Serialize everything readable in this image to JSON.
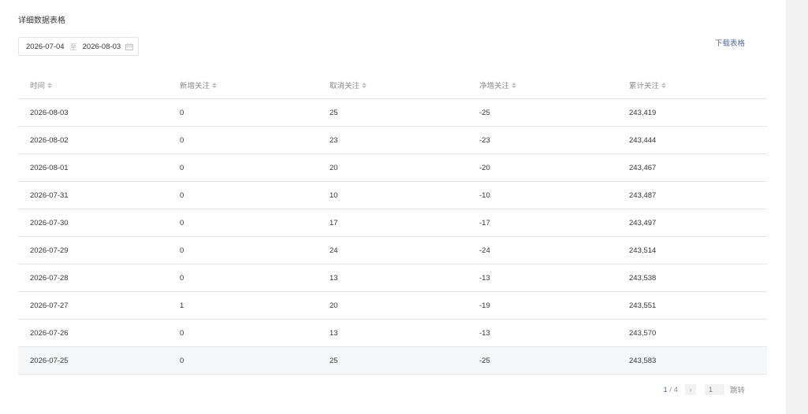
{
  "section_title": "详细数据表格",
  "date_range": {
    "start": "2026-07-04",
    "separator": "至",
    "end": "2026-08-03",
    "icon": "calendar-icon"
  },
  "download_label": "下载表格",
  "table": {
    "columns": [
      "时间",
      "新增关注",
      "取消关注",
      "净增关注",
      "累计关注"
    ],
    "rows": [
      [
        "2026-08-03",
        "0",
        "25",
        "-25",
        "243,419"
      ],
      [
        "2026-08-02",
        "0",
        "23",
        "-23",
        "243,444"
      ],
      [
        "2026-08-01",
        "0",
        "20",
        "-20",
        "243,467"
      ],
      [
        "2026-07-31",
        "0",
        "10",
        "-10",
        "243,487"
      ],
      [
        "2026-07-30",
        "0",
        "17",
        "-17",
        "243,497"
      ],
      [
        "2026-07-29",
        "0",
        "24",
        "-24",
        "243,514"
      ],
      [
        "2026-07-28",
        "0",
        "13",
        "-13",
        "243,538"
      ],
      [
        "2026-07-27",
        "1",
        "20",
        "-19",
        "243,551"
      ],
      [
        "2026-07-26",
        "0",
        "13",
        "-13",
        "243,570"
      ],
      [
        "2026-07-25",
        "0",
        "25",
        "-25",
        "243,583"
      ]
    ],
    "highlighted_row_index": 9
  },
  "pagination": {
    "current": "1",
    "separator": " / ",
    "total": "4",
    "next_icon": "chevron-right-icon",
    "jump_placeholder": "1",
    "jump_label": "跳转"
  },
  "colors": {
    "link": "#576b95",
    "border": "#e7e7eb",
    "hover_row": "#f6f7f9"
  }
}
